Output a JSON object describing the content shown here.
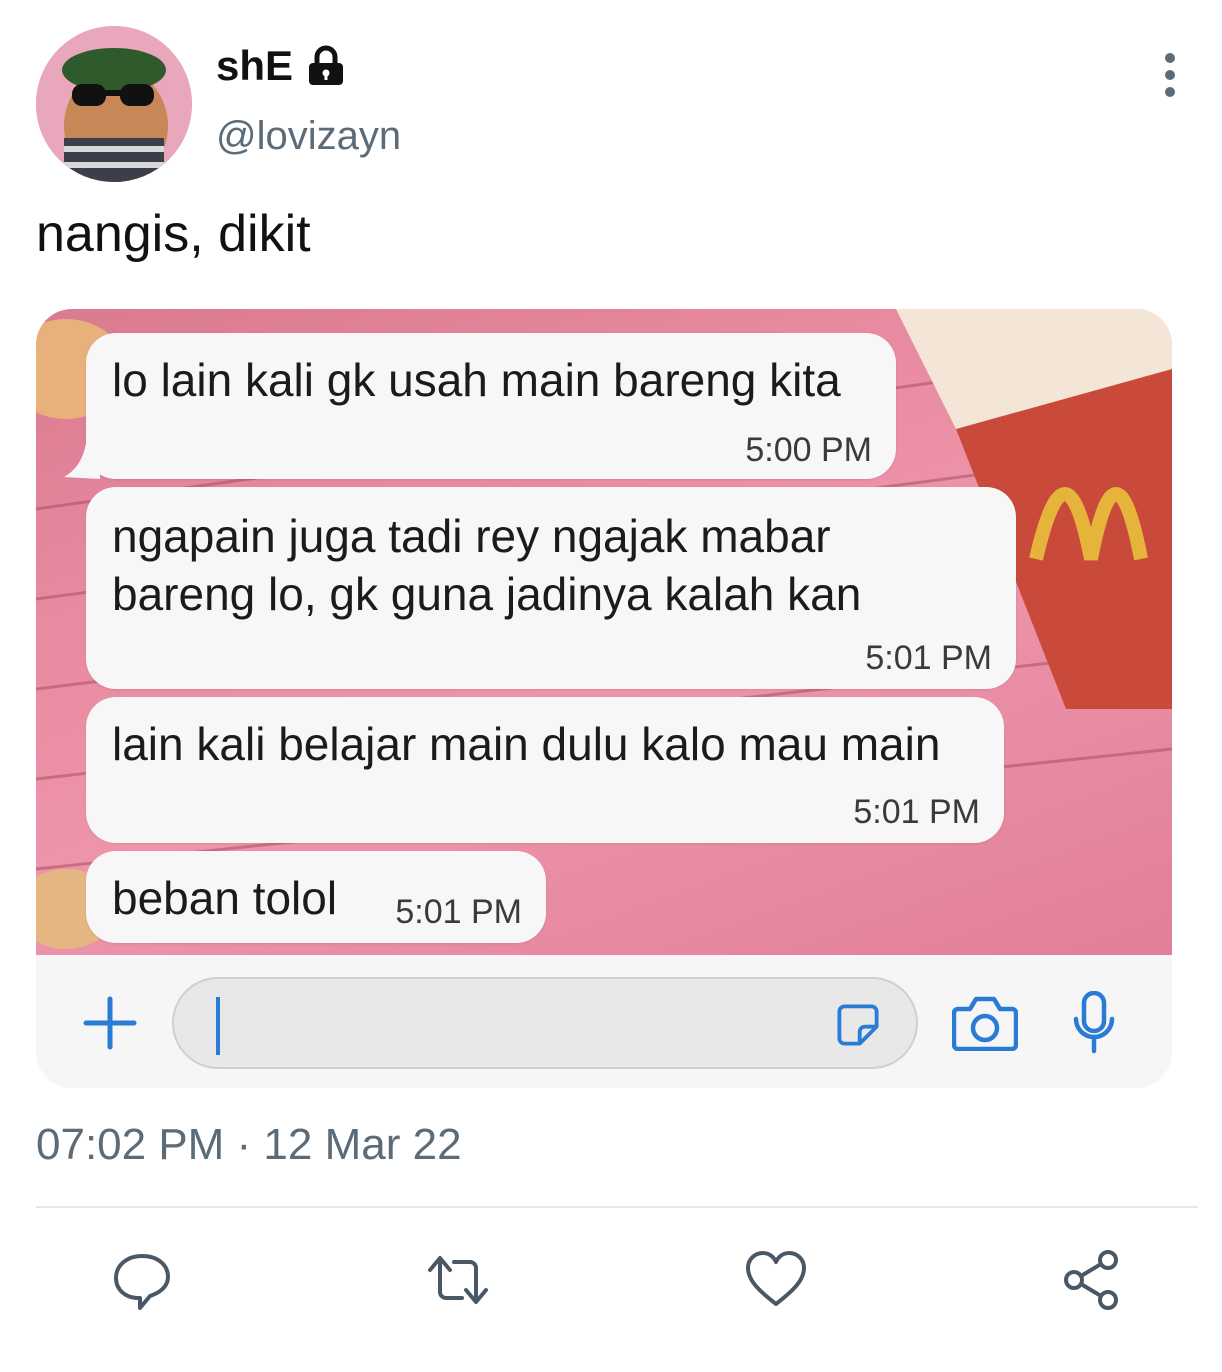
{
  "author": {
    "name": "shE",
    "handle": "@lovizayn"
  },
  "tweet": {
    "text": "nangis, dikit",
    "timestamp": "07:02 PM · 12 Mar 22"
  },
  "chat": {
    "messages": [
      {
        "text": "lo lain kali gk usah main bareng kita",
        "time": "5:00 PM"
      },
      {
        "text": "ngapain juga tadi rey ngajak mabar\nbareng lo, gk guna jadinya kalah kan",
        "time": "5:01 PM"
      },
      {
        "text": "lain kali belajar main dulu kalo mau main",
        "time": "5:01 PM"
      },
      {
        "text": "beban tolol",
        "time": "5:01 PM"
      }
    ],
    "input_value": ""
  },
  "colors": {
    "accent": "#2a7bd6",
    "secondary_text": "#5c6b78",
    "chat_background": "#e88aa0"
  },
  "icons": {
    "lock": "lock-icon",
    "more": "more-vertical-icon",
    "plus": "plus-icon",
    "sticker": "sticker-icon",
    "camera": "camera-icon",
    "mic": "microphone-icon",
    "reply": "reply-icon",
    "retweet": "retweet-icon",
    "like": "heart-icon",
    "share": "share-icon"
  }
}
